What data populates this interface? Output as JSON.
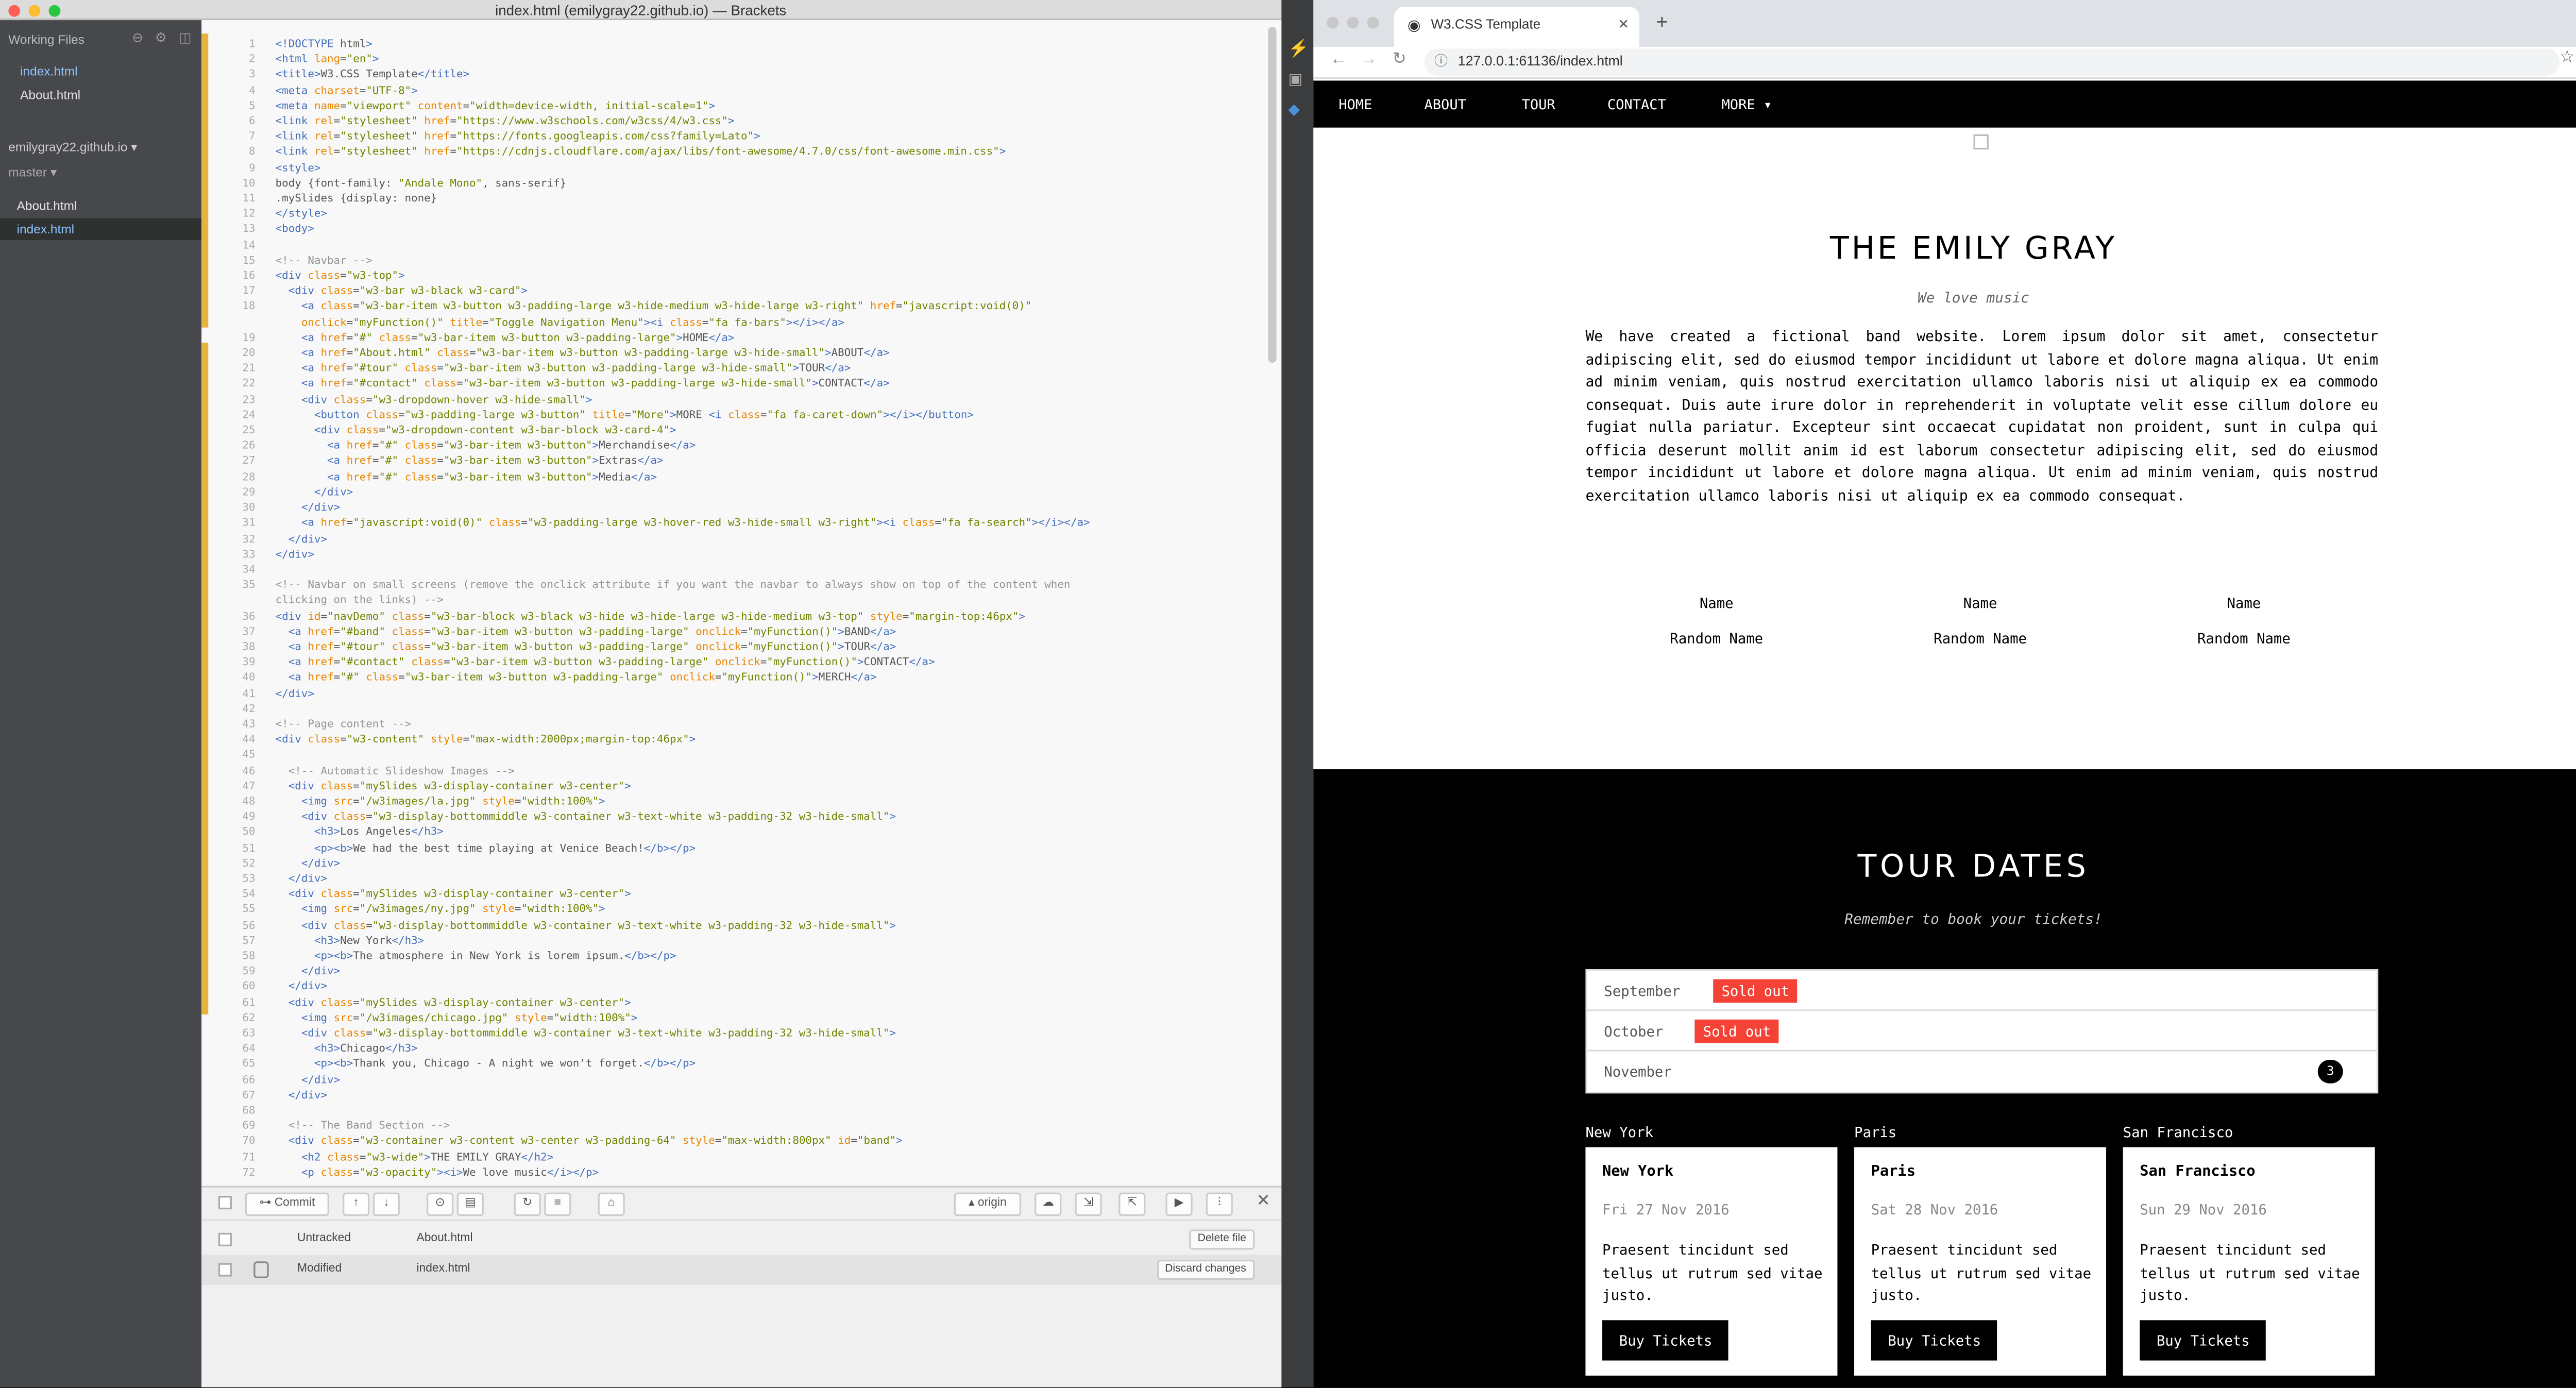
{
  "brackets": {
    "title": "index.html (emilygray22.github.io) — Brackets",
    "working_files_label": "Working Files",
    "working_files": [
      "index.html",
      "About.html"
    ],
    "project_name": "emilygray22.github.io ▾",
    "branch": "master ▾",
    "tree_files": [
      "About.html",
      "index.html"
    ],
    "code_lines": [
      "<!DOCTYPE html>",
      "<html lang=\"en\">",
      "<title>W3.CSS Template</title>",
      "<meta charset=\"UTF-8\">",
      "<meta name=\"viewport\" content=\"width=device-width, initial-scale=1\">",
      "<link rel=\"stylesheet\" href=\"https://www.w3schools.com/w3css/4/w3.css\">",
      "<link rel=\"stylesheet\" href=\"https://fonts.googleapis.com/css?family=Lato\">",
      "<link rel=\"stylesheet\" href=\"https://cdnjs.cloudflare.com/ajax/libs/font-awesome/4.7.0/css/font-awesome.min.css\">",
      "<style>",
      "body {font-family: \"Andale Mono\", sans-serif}",
      ".mySlides {display: none}",
      "</style>",
      "<body>",
      "",
      "<!-- Navbar -->",
      "<div class=\"w3-top\">",
      "  <div class=\"w3-bar w3-black w3-card\">",
      "    <a class=\"w3-bar-item w3-button w3-padding-large w3-hide-medium w3-hide-large w3-right\" href=\"javascript:void(0)\"",
      "    onclick=\"myFunction()\" title=\"Toggle Navigation Menu\"><i class=\"fa fa-bars\"></i></a>",
      "    <a href=\"#\" class=\"w3-bar-item w3-button w3-padding-large\">HOME</a>",
      "    <a href=\"About.html\" class=\"w3-bar-item w3-button w3-padding-large w3-hide-small\">ABOUT</a>",
      "    <a href=\"#tour\" class=\"w3-bar-item w3-button w3-padding-large w3-hide-small\">TOUR</a>",
      "    <a href=\"#contact\" class=\"w3-bar-item w3-button w3-padding-large w3-hide-small\">CONTACT</a>",
      "    <div class=\"w3-dropdown-hover w3-hide-small\">",
      "      <button class=\"w3-padding-large w3-button\" title=\"More\">MORE <i class=\"fa fa-caret-down\"></i></button>",
      "      <div class=\"w3-dropdown-content w3-bar-block w3-card-4\">",
      "        <a href=\"#\" class=\"w3-bar-item w3-button\">Merchandise</a>",
      "        <a href=\"#\" class=\"w3-bar-item w3-button\">Extras</a>",
      "        <a href=\"#\" class=\"w3-bar-item w3-button\">Media</a>",
      "      </div>",
      "    </div>",
      "    <a href=\"javascript:void(0)\" class=\"w3-padding-large w3-hover-red w3-hide-small w3-right\"><i class=\"fa fa-search\"></i></a>",
      "  </div>",
      "</div>",
      "",
      "<!-- Navbar on small screens (remove the onclick attribute if you want the navbar to always show on top of the content when",
      "clicking on the links) -->",
      "<div id=\"navDemo\" class=\"w3-bar-block w3-black w3-hide w3-hide-large w3-hide-medium w3-top\" style=\"margin-top:46px\">",
      "  <a href=\"#band\" class=\"w3-bar-item w3-button w3-padding-large\" onclick=\"myFunction()\">BAND</a>",
      "  <a href=\"#tour\" class=\"w3-bar-item w3-button w3-padding-large\" onclick=\"myFunction()\">TOUR</a>",
      "  <a href=\"#contact\" class=\"w3-bar-item w3-button w3-padding-large\" onclick=\"myFunction()\">CONTACT</a>",
      "  <a href=\"#\" class=\"w3-bar-item w3-button w3-padding-large\" onclick=\"myFunction()\">MERCH</a>",
      "</div>",
      "",
      "<!-- Page content -->",
      "<div class=\"w3-content\" style=\"max-width:2000px;margin-top:46px\">",
      "",
      "  <!-- Automatic Slideshow Images -->",
      "  <div class=\"mySlides w3-display-container w3-center\">",
      "    <img src=\"/w3images/la.jpg\" style=\"width:100%\">",
      "    <div class=\"w3-display-bottommiddle w3-container w3-text-white w3-padding-32 w3-hide-small\">",
      "      <h3>Los Angeles</h3>",
      "      <p><b>We had the best time playing at Venice Beach!</b></p>",
      "    </div>",
      "  </div>",
      "  <div class=\"mySlides w3-display-container w3-center\">",
      "    <img src=\"/w3images/ny.jpg\" style=\"width:100%\">",
      "    <div class=\"w3-display-bottommiddle w3-container w3-text-white w3-padding-32 w3-hide-small\">",
      "      <h3>New York</h3>",
      "      <p><b>The atmosphere in New York is lorem ipsum.</b></p>",
      "    </div>",
      "  </div>",
      "  <div class=\"mySlides w3-display-container w3-center\">",
      "    <img src=\"/w3images/chicago.jpg\" style=\"width:100%\">",
      "    <div class=\"w3-display-bottommiddle w3-container w3-text-white w3-padding-32 w3-hide-small\">",
      "      <h3>Chicago</h3>",
      "      <p><b>Thank you, Chicago - A night we won't forget.</b></p>",
      "    </div>",
      "  </div>",
      "",
      "  <!-- The Band Section -->",
      "  <div class=\"w3-container w3-content w3-center w3-padding-64\" style=\"max-width:800px\" id=\"band\">",
      "    <h2 class=\"w3-wide\">THE EMILY GRAY</h2>",
      "    <p class=\"w3-opacity\"><i>We love music</i></p>"
    ],
    "line_numbers": [
      "1",
      "2",
      "3",
      "4",
      "5",
      "6",
      "7",
      "8",
      "9",
      "10",
      "11",
      "12",
      "13",
      "14",
      "15",
      "16",
      "17",
      "18",
      "",
      "19",
      "20",
      "21",
      "22",
      "23",
      "24",
      "25",
      "26",
      "27",
      "28",
      "29",
      "30",
      "31",
      "32",
      "33",
      "34",
      "35",
      "",
      "36",
      "37",
      "38",
      "39",
      "40",
      "41",
      "42",
      "43",
      "44",
      "45",
      "46",
      "47",
      "48",
      "49",
      "50",
      "51",
      "52",
      "53",
      "54",
      "55",
      "56",
      "57",
      "58",
      "59",
      "60",
      "61",
      "62",
      "63",
      "64",
      "65",
      "66",
      "67",
      "68",
      "69",
      "70",
      "71",
      "72"
    ],
    "git": {
      "commit_label": "Commit",
      "origin_label": "origin",
      "rows": [
        {
          "status": "Untracked",
          "file": "About.html",
          "action": "Delete file"
        },
        {
          "status": "Modified",
          "file": "index.html",
          "action": "Discard changes"
        }
      ]
    }
  },
  "chrome": {
    "tab_title": "W3.CSS Template",
    "url": "127.0.0.1:61136/index.html",
    "nav": [
      "HOME",
      "ABOUT",
      "TOUR",
      "CONTACT",
      "MORE"
    ],
    "band": {
      "title": "THE EMILY GRAY",
      "subtitle": "We love music",
      "text": "We have created a fictional band website. Lorem ipsum dolor sit amet, consectetur adipiscing elit, sed do eiusmod tempor incididunt ut labore et dolore magna aliqua. Ut enim ad minim veniam, quis nostrud exercitation ullamco laboris nisi ut aliquip ex ea commodo consequat. Duis aute irure dolor in reprehenderit in voluptate velit esse cillum dolore eu fugiat nulla pariatur. Excepteur sint occaecat cupidatat non proident, sunt in culpa qui officia deserunt mollit anim id est laborum consectetur adipiscing elit, sed do eiusmod tempor incididunt ut labore et dolore magna aliqua. Ut enim ad minim veniam, quis nostrud exercitation ullamco laboris nisi ut aliquip ex ea commodo consequat.",
      "members": [
        {
          "name": "Name",
          "alt": "Random Name"
        },
        {
          "name": "Name",
          "alt": "Random Name"
        },
        {
          "name": "Name",
          "alt": "Random Name"
        }
      ]
    },
    "tour": {
      "title": "TOUR DATES",
      "subtitle": "Remember to book your tickets!",
      "months": [
        {
          "name": "September",
          "tag": "Sold out"
        },
        {
          "name": "October",
          "tag": "Sold out"
        },
        {
          "name": "November",
          "badge": "3"
        }
      ],
      "cards": [
        {
          "alt": "New York",
          "title": "New York",
          "date": "Fri 27 Nov 2016",
          "text": "Praesent tincidunt sed tellus ut rutrum sed vitae justo.",
          "button": "Buy Tickets"
        },
        {
          "alt": "Paris",
          "title": "Paris",
          "date": "Sat 28 Nov 2016",
          "text": "Praesent tincidunt sed tellus ut rutrum sed vitae justo.",
          "button": "Buy Tickets"
        },
        {
          "alt": "San Francisco",
          "title": "San Francisco",
          "date": "Sun 29 Nov 2016",
          "text": "Praesent tincidunt sed tellus ut rutrum sed vitae justo.",
          "button": "Buy Tickets"
        }
      ]
    }
  },
  "colors": {
    "modified_bar": "#e6b33f",
    "sold_out": "#f44336",
    "nav_bg": "#000000"
  }
}
